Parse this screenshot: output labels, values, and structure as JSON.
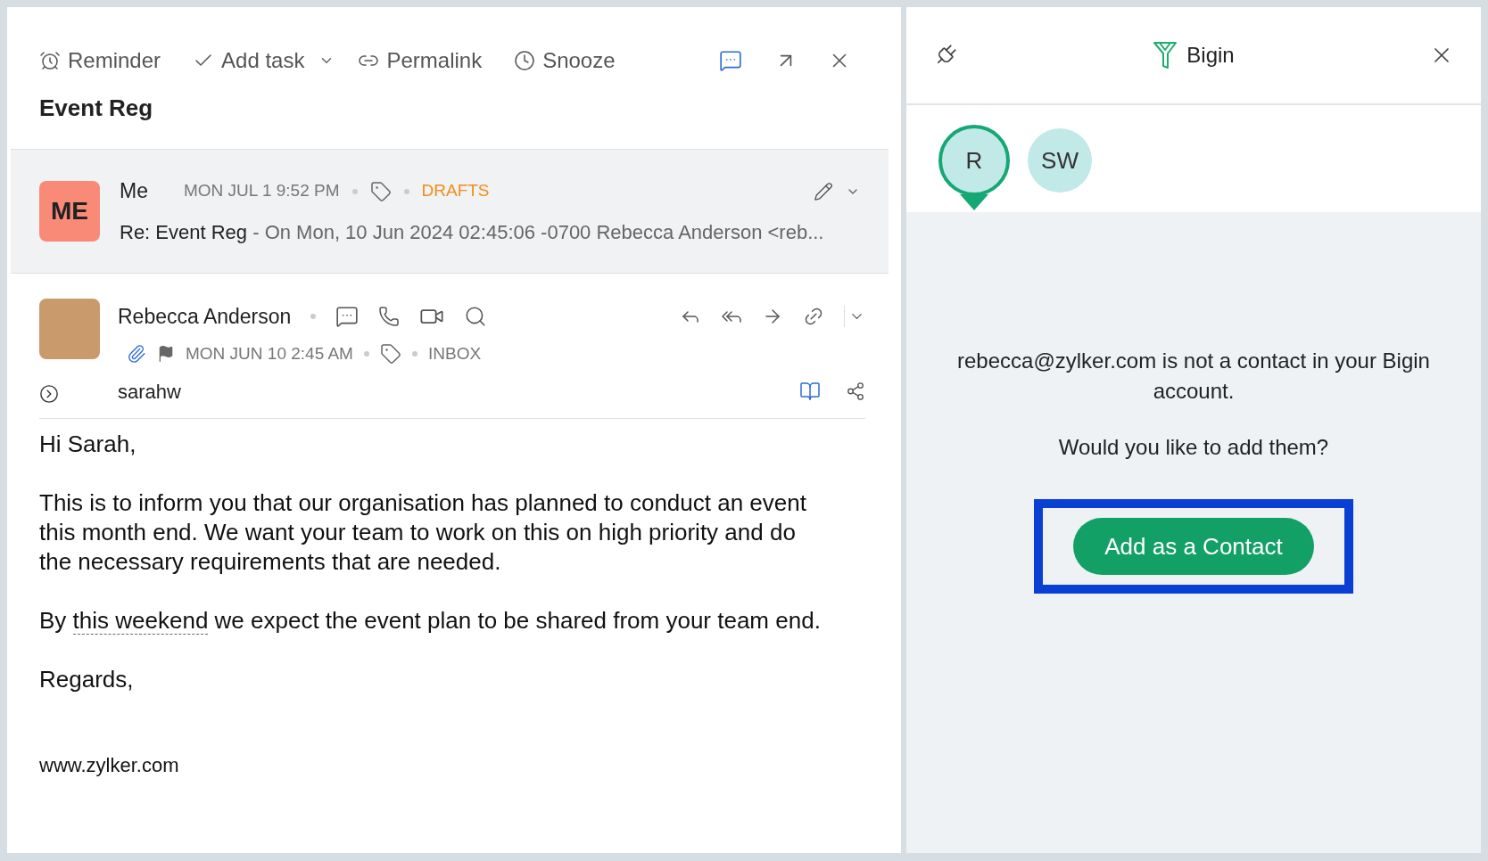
{
  "toolbar": {
    "actions": [
      {
        "kind": "reminder",
        "label": "Reminder"
      },
      {
        "kind": "task",
        "label": "Add task"
      },
      {
        "kind": "permalink",
        "label": "Permalink"
      },
      {
        "kind": "snooze",
        "label": "Snooze"
      }
    ]
  },
  "subject": "Event Reg",
  "draft": {
    "initials": "ME",
    "sender": "Me",
    "date": "MON JUL 1 9:52 PM",
    "folder": "DRAFTS",
    "subject": "Re: Event Reg",
    "preview": "- On Mon, 10 Jun 2024 02:45:06 -0700 Rebecca Anderson <reb..."
  },
  "message": {
    "sender": "Rebecca Anderson",
    "date": "MON JUN 10 2:45 AM",
    "folder": "INBOX",
    "to": "sarahw",
    "has_attachment": true
  },
  "body": [
    {
      "kind": "text",
      "text": "Hi Sarah,"
    },
    {
      "kind": "text",
      "text": "This is to inform you that our organisation has planned to conduct an event this month end. We want your team to work on this on high priority and do the necessary requirements that are needed."
    },
    {
      "kind": "mixed",
      "before": "By ",
      "link": "this weekend",
      "after": " we expect the event plan to be shared from your team end."
    },
    {
      "kind": "text",
      "text": "Regards,"
    },
    {
      "kind": "signature",
      "text": "www.zylker.com"
    }
  ],
  "crm_panel": {
    "title": "Bigin",
    "contacts": [
      {
        "initials": "R",
        "selected": true
      },
      {
        "initials": "SW",
        "selected": false
      }
    ],
    "message": "rebecca@zylker.com is not a contact in your Bigin account.",
    "question": "Would you like to add them?",
    "button": "Add as a Contact"
  }
}
